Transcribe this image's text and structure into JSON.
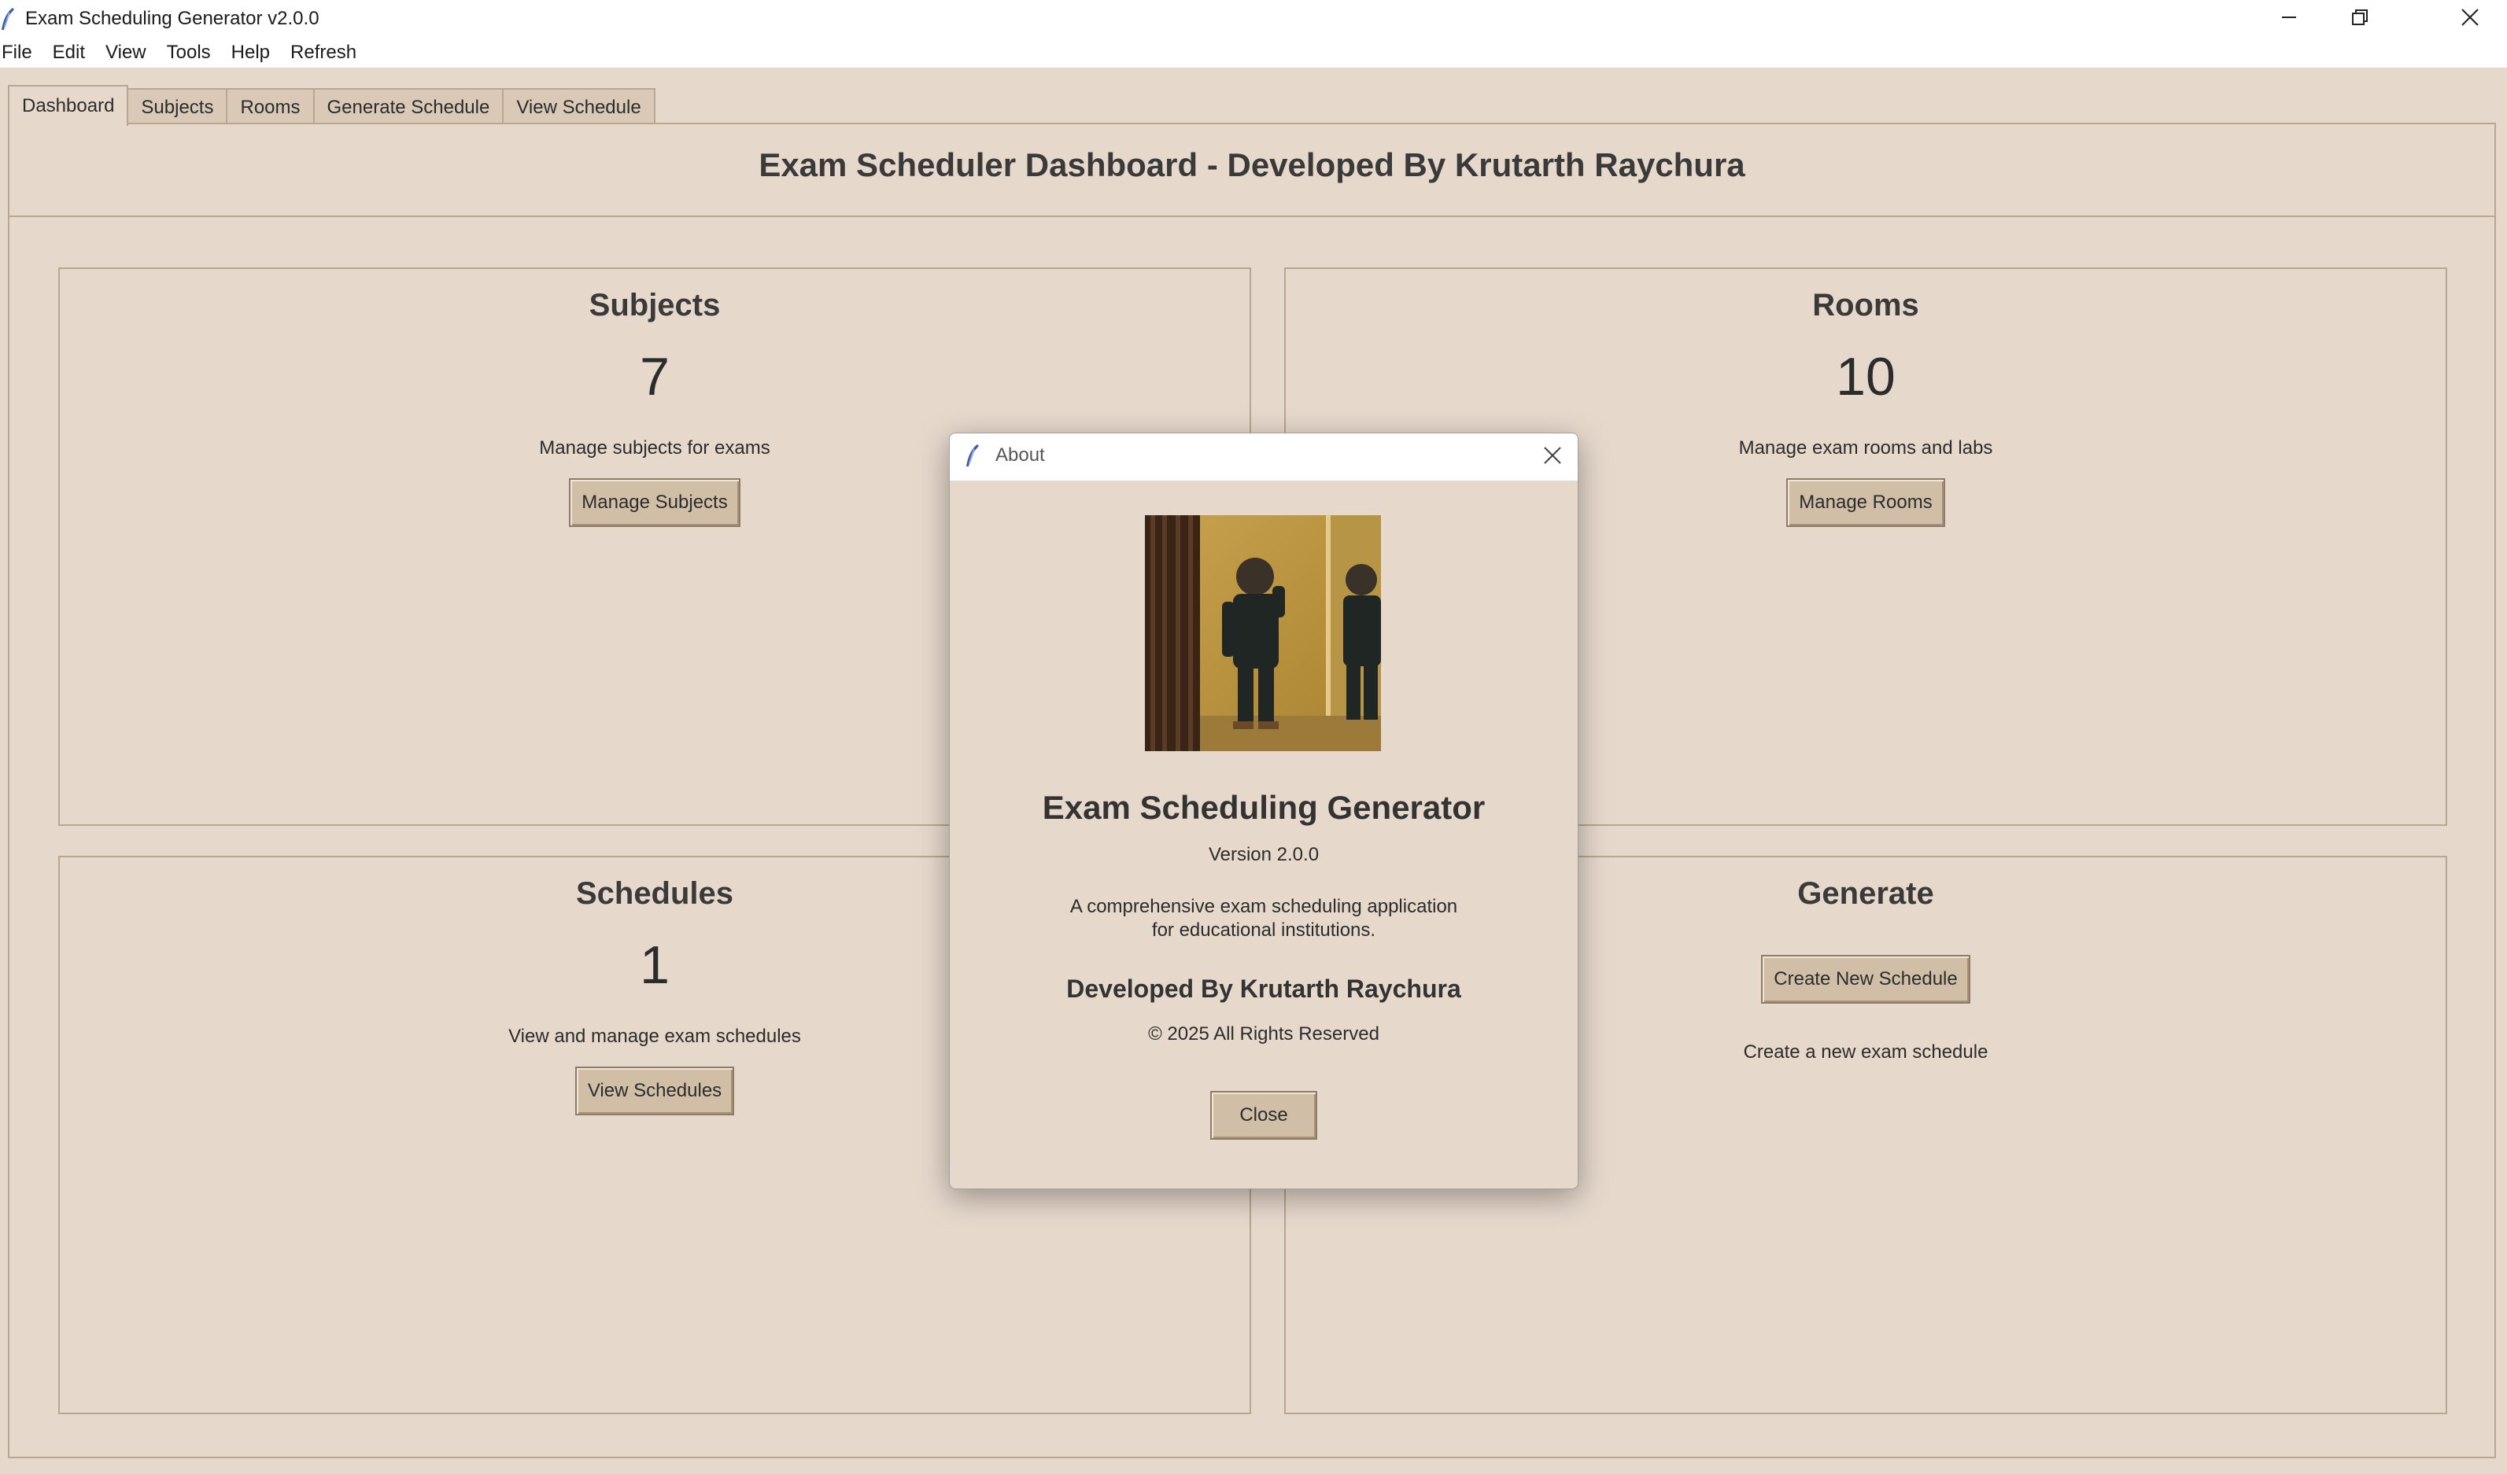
{
  "window": {
    "title": "Exam Scheduling Generator v2.0.0"
  },
  "menu": [
    "File",
    "Edit",
    "View",
    "Tools",
    "Help",
    "Refresh"
  ],
  "tabs": [
    {
      "label": "Dashboard",
      "active": true
    },
    {
      "label": "Subjects",
      "active": false
    },
    {
      "label": "Rooms",
      "active": false
    },
    {
      "label": "Generate Schedule",
      "active": false
    },
    {
      "label": "View Schedule",
      "active": false
    }
  ],
  "dashboard": {
    "title": "Exam Scheduler Dashboard - Developed By Krutarth Raychura",
    "cards": {
      "subjects": {
        "title": "Subjects",
        "count": "7",
        "description": "Manage subjects for exams",
        "button": "Manage Subjects"
      },
      "rooms": {
        "title": "Rooms",
        "count": "10",
        "description": "Manage exam rooms and labs",
        "button": "Manage Rooms"
      },
      "schedules": {
        "title": "Schedules",
        "count": "1",
        "description": "View and manage exam schedules",
        "button": "View Schedules"
      },
      "generate": {
        "title": "Generate",
        "button": "Create New Schedule",
        "description": "Create a new exam schedule"
      }
    }
  },
  "about_dialog": {
    "title": "About",
    "app_name": "Exam Scheduling Generator",
    "version": "Version 2.0.0",
    "description_line1": "A comprehensive exam scheduling application",
    "description_line2": "for educational institutions.",
    "developer": "Developed By Krutarth Raychura",
    "copyright": "© 2025 All Rights Reserved",
    "close_button": "Close"
  },
  "colors": {
    "background": "#e6d9cc",
    "button": "#d1bea6",
    "border": "#b8a690"
  },
  "icons": [
    "feather-icon",
    "minimize-icon",
    "restore-icon",
    "close-icon"
  ]
}
